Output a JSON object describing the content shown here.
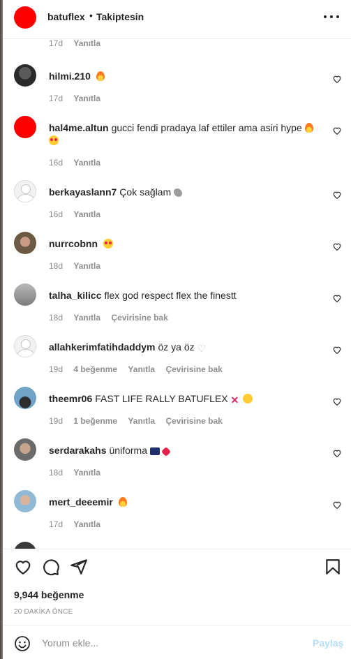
{
  "header": {
    "username": "batuflex",
    "separator": "•",
    "follow_status": "Takiptesin"
  },
  "top_partial": {
    "time": "17d",
    "reply": "Yanıtla"
  },
  "comments": [
    {
      "user": "hilmi.210",
      "text": "",
      "emojis": [
        "fire"
      ],
      "time": "17d",
      "likes": "",
      "reply": "Yanıtla",
      "translate": ""
    },
    {
      "user": "hal4me.altun",
      "text": "gucci fendi pradaya laf ettiler ama asiri hype",
      "emojis": [
        "fire",
        "heart-eyes"
      ],
      "time": "16d",
      "likes": "",
      "reply": "Yanıtla",
      "translate": ""
    },
    {
      "user": "berkayaslann7",
      "text": "Çok sağlam",
      "emojis": [
        "muscle"
      ],
      "time": "16d",
      "likes": "",
      "reply": "Yanıtla",
      "translate": ""
    },
    {
      "user": "nurrcobnn",
      "text": "",
      "emojis": [
        "heart-eyes"
      ],
      "time": "18d",
      "likes": "",
      "reply": "Yanıtla",
      "translate": ""
    },
    {
      "user": "talha_kilicc",
      "text": "flex god respect flex the finestt",
      "emojis": [],
      "time": "18d",
      "likes": "",
      "reply": "Yanıtla",
      "translate": "Çevirisine bak"
    },
    {
      "user": "allahkerimfatihdaddym",
      "text": "öz ya öz",
      "emojis": [
        "white-heart"
      ],
      "time": "19d",
      "likes": "4 beğenme",
      "reply": "Yanıtla",
      "translate": "Çevirisine bak"
    },
    {
      "user": "theemr06",
      "text": "FAST LIFE RALLY BATUFLEX",
      "emojis": [
        "cross-mark",
        "face"
      ],
      "time": "19d",
      "likes": "1 beğenme",
      "reply": "Yanıtla",
      "translate": "Çevirisine bak"
    },
    {
      "user": "serdarakahs",
      "text": "üniforma",
      "emojis": [
        "flag",
        "heart"
      ],
      "time": "18d",
      "likes": "",
      "reply": "Yanıtla",
      "translate": ""
    },
    {
      "user": "mert_deeemir",
      "text": "",
      "emojis": [
        "fire"
      ],
      "time": "17d",
      "likes": "",
      "reply": "Yanıtla",
      "translate": ""
    }
  ],
  "footer": {
    "likes": "9,944 beğenme",
    "time_ago": "20 DAKİKA ÖNCE",
    "comment_placeholder": "Yorum ekle...",
    "post_label": "Paylaş"
  },
  "colors": {
    "text": "#262626",
    "muted": "#8e8e8e",
    "post_button": "#b2dffc",
    "avatar_red": "#ff0000"
  },
  "icons": [
    "more-options-icon",
    "like-heart-icon",
    "comment-icon",
    "share-icon",
    "save-bookmark-icon",
    "emoji-smile-icon"
  ]
}
